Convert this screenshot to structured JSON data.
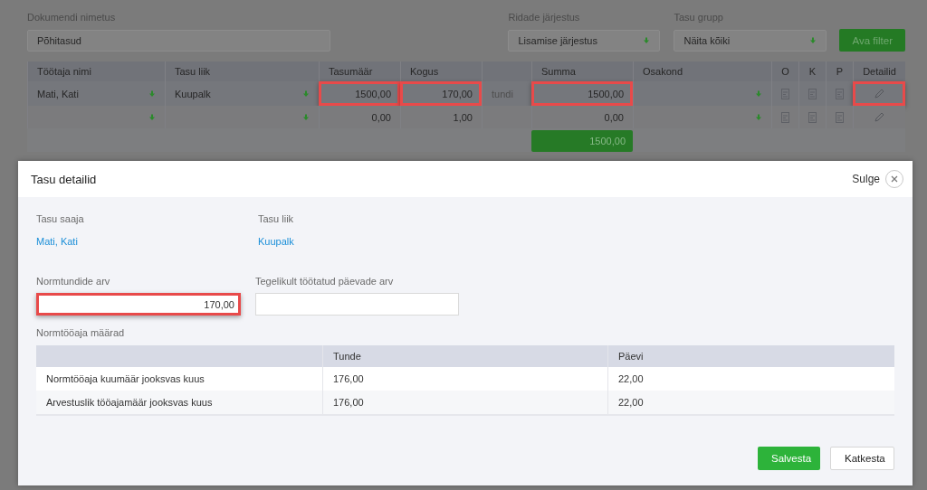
{
  "form": {
    "document_name": {
      "label": "Dokumendi nimetus",
      "value": "Põhitasud"
    },
    "row_order": {
      "label": "Ridade järjestus",
      "value": "Lisamise järjestus"
    },
    "pay_group": {
      "label": "Tasu grupp",
      "value": "Näita kõiki"
    },
    "filter_button": "Ava filter"
  },
  "table": {
    "columns": [
      "Töötaja nimi",
      "Tasu liik",
      "Tasumäär",
      "Kogus",
      "Summa",
      "Osakond",
      "O",
      "K",
      "P",
      "Detailid"
    ],
    "rows": [
      {
        "employee": "Mati, Kati",
        "pay_type": "Kuupalk",
        "rate": {
          "text": "1500,00",
          "highlighted": true
        },
        "quantity": {
          "text": "170,00",
          "highlighted": true
        },
        "unit": "tundi",
        "sum": {
          "text": "1500,00",
          "highlighted": true
        },
        "details_highlighted": true
      },
      {
        "rate": {
          "text": "0,00",
          "highlighted": false
        },
        "quantity": {
          "text": "1,00",
          "highlighted": false
        },
        "sum": {
          "text": "0,00",
          "highlighted": false
        },
        "details_highlighted": false
      }
    ],
    "total": "1500,00"
  },
  "modal": {
    "title": "Tasu detailid",
    "close_label": "Sulge",
    "recipient": {
      "label": "Tasu saaja",
      "value": "Mati, Kati"
    },
    "pay_type": {
      "label": "Tasu liik",
      "value": "Kuupalk"
    },
    "norm_hours": {
      "label": "Normtundide arv",
      "value": "170,00",
      "highlighted": true
    },
    "actual_days": {
      "label": "Tegelikult töötatud päevade arv"
    },
    "rates": {
      "title": "Normtööaja määrad",
      "columns": [
        "Tunde",
        "Päevi"
      ],
      "rows": [
        {
          "label": "Normtööaja kuumäär jooksvas kuus",
          "hours": "176,00",
          "days": "22,00"
        },
        {
          "label": "Arvestuslik tööajamäär jooksvas kuus",
          "hours": "176,00",
          "days": "22,00"
        }
      ]
    },
    "buttons": [
      {
        "label": "Salvesta",
        "kind": "primary"
      },
      {
        "label": "Katkesta",
        "kind": "secondary"
      }
    ]
  }
}
